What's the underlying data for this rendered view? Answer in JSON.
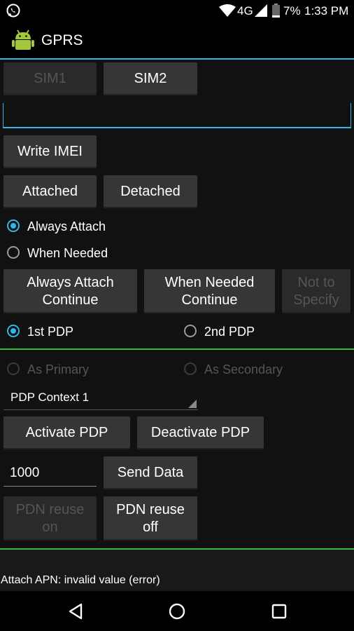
{
  "status": {
    "network": "4G",
    "battery": "7%",
    "time": "1:33 PM"
  },
  "app": {
    "title": "GPRS"
  },
  "sim_buttons": [
    "SIM1",
    "SIM2"
  ],
  "imei_input": {
    "value": ""
  },
  "write_imei": "Write IMEI",
  "attach_buttons": [
    "Attached",
    "Detached"
  ],
  "attach_modes": [
    "Always Attach",
    "When Needed"
  ],
  "mode_buttons": [
    "Always Attach Continue",
    "When Needed Continue",
    "Not to Specify"
  ],
  "pdp_select": [
    "1st PDP",
    "2nd PDP"
  ],
  "primary_options": [
    "As Primary",
    "As Secondary"
  ],
  "pdp_context": "PDP Context 1",
  "pdp_buttons": [
    "Activate PDP",
    "Deactivate PDP"
  ],
  "data_input": {
    "value": "1000"
  },
  "send_data": "Send Data",
  "pdn_buttons": [
    "PDN reuse on",
    "PDN reuse off"
  ],
  "status_message": "Attach APN: invalid value (error)",
  "colors": {
    "accent": "#33b5e5",
    "divider": "#2fbd3a"
  }
}
